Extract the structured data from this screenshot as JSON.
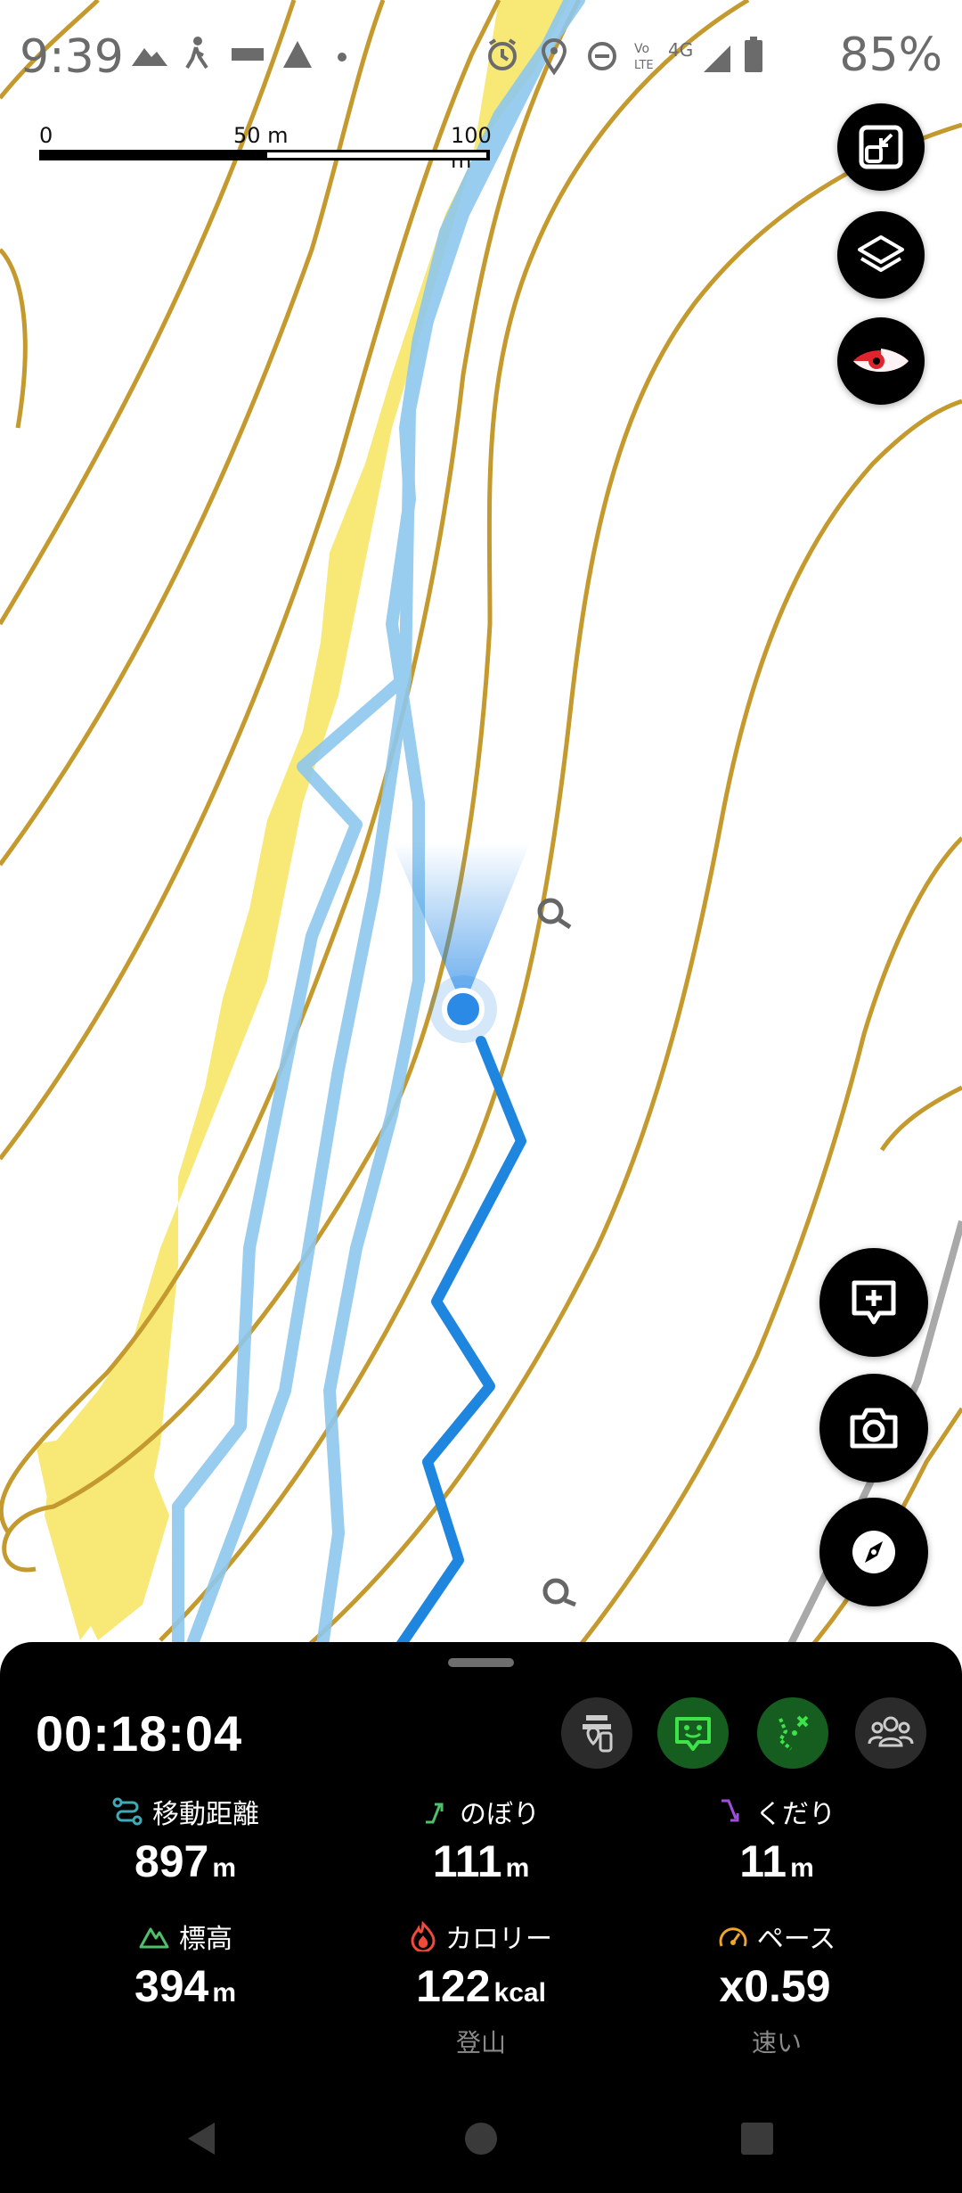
{
  "status_bar": {
    "time": "9:39",
    "battery_percent": "85%",
    "network": "4G",
    "left_icons": [
      "mountain-icon",
      "walking-icon",
      "news-icon",
      "triangle-icon",
      "dot-icon"
    ],
    "right_icons": [
      "alarm-icon",
      "location-icon",
      "dnd-icon",
      "volte-icon",
      "signal-icon",
      "battery-icon"
    ]
  },
  "scale_bar": {
    "labels": [
      "0",
      "50 m",
      "100 m"
    ]
  },
  "map_buttons": {
    "top": [
      "fullscreen-exit-icon",
      "layers-icon",
      "eye-icon"
    ],
    "bottom": [
      "add-memo-icon",
      "camera-icon",
      "compass-icon"
    ]
  },
  "colors": {
    "contour": "#c49a2e",
    "trail": "#8ec8ee",
    "track": "#1f86e0",
    "location": "#2a8ae6",
    "highlight": "#f6e24a",
    "panel_bg": "#000000",
    "green_btn": "#155e1f"
  },
  "panel": {
    "elapsed_time": "00:18:04",
    "stats": [
      {
        "label": "移動距離",
        "value": "897",
        "unit": "m",
        "icon": "route-icon"
      },
      {
        "label": "のぼり",
        "value": "111",
        "unit": "m",
        "icon": "ascent-icon"
      },
      {
        "label": "くだり",
        "value": "11",
        "unit": "m",
        "icon": "descent-icon"
      },
      {
        "label": "標高",
        "value": "394",
        "unit": "m",
        "icon": "mountain-outline-icon"
      },
      {
        "label": "カロリー",
        "value": "122",
        "unit": "kcal",
        "icon": "flame-icon",
        "sub": "登山"
      },
      {
        "label": "ペース",
        "value": "x0.59",
        "unit": "",
        "icon": "speedometer-icon",
        "sub": "速い"
      }
    ]
  },
  "nav": [
    "back-icon",
    "home-icon",
    "recents-icon"
  ]
}
